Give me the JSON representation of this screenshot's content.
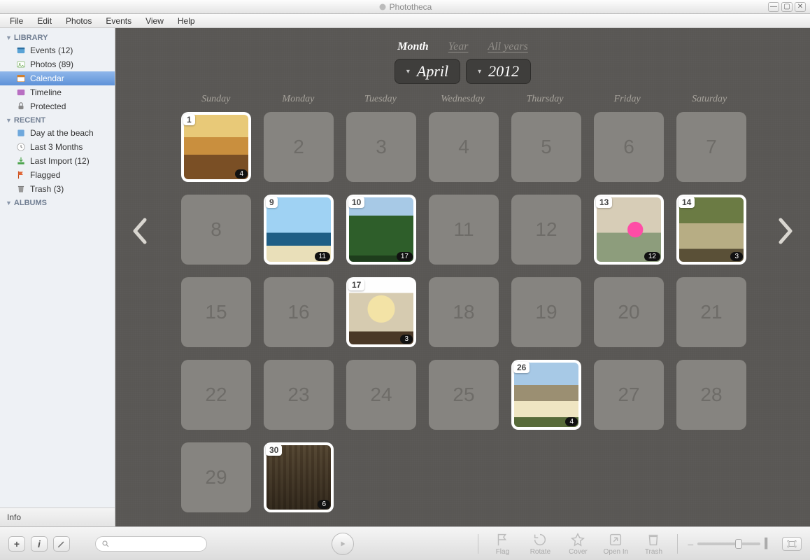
{
  "app": {
    "title": "Phototheca"
  },
  "menu": [
    "File",
    "Edit",
    "Photos",
    "Events",
    "View",
    "Help"
  ],
  "sidebar": {
    "sections": [
      {
        "label": "LIBRARY",
        "items": [
          {
            "icon": "events-icon",
            "label": "Events (12)"
          },
          {
            "icon": "photos-icon",
            "label": "Photos (89)"
          },
          {
            "icon": "calendar-icon",
            "label": "Calendar",
            "selected": true
          },
          {
            "icon": "timeline-icon",
            "label": "Timeline"
          },
          {
            "icon": "protected-icon",
            "label": "Protected"
          }
        ]
      },
      {
        "label": "RECENT",
        "items": [
          {
            "icon": "album-icon",
            "label": "Day at the beach"
          },
          {
            "icon": "clock-icon",
            "label": "Last 3 Months"
          },
          {
            "icon": "import-icon",
            "label": "Last Import (12)"
          },
          {
            "icon": "flag-icon",
            "label": "Flagged"
          },
          {
            "icon": "trash-icon",
            "label": "Trash (3)"
          }
        ]
      },
      {
        "label": "ALBUMS",
        "items": []
      }
    ],
    "info": "Info"
  },
  "view": {
    "tabs": {
      "month": "Month",
      "year": "Year",
      "all": "All years",
      "active": "month"
    },
    "picker": {
      "month": "April",
      "year": "2012"
    },
    "weekdays": [
      "Sunday",
      "Monday",
      "Tuesday",
      "Wednesday",
      "Thursday",
      "Friday",
      "Saturday"
    ]
  },
  "calendar": {
    "cells": [
      {
        "day": 1,
        "photo": true,
        "count": 4,
        "thumb": "t1"
      },
      {
        "day": 2
      },
      {
        "day": 3
      },
      {
        "day": 4
      },
      {
        "day": 5
      },
      {
        "day": 6
      },
      {
        "day": 7
      },
      {
        "day": 8
      },
      {
        "day": 9,
        "photo": true,
        "count": 11,
        "thumb": "t9"
      },
      {
        "day": 10,
        "photo": true,
        "count": 17,
        "thumb": "t10"
      },
      {
        "day": 11
      },
      {
        "day": 12
      },
      {
        "day": 13,
        "photo": true,
        "count": 12,
        "thumb": "t13"
      },
      {
        "day": 14,
        "photo": true,
        "count": 3,
        "thumb": "t14"
      },
      {
        "day": 15
      },
      {
        "day": 16
      },
      {
        "day": 17,
        "photo": true,
        "count": 3,
        "thumb": "t17"
      },
      {
        "day": 18
      },
      {
        "day": 19
      },
      {
        "day": 20
      },
      {
        "day": 21
      },
      {
        "day": 22
      },
      {
        "day": 23
      },
      {
        "day": 24
      },
      {
        "day": 25
      },
      {
        "day": 26,
        "photo": true,
        "count": 4,
        "thumb": "t26"
      },
      {
        "day": 27
      },
      {
        "day": 28
      },
      {
        "day": 29
      },
      {
        "day": 30,
        "photo": true,
        "count": 6,
        "thumb": "t30"
      }
    ]
  },
  "toolbar": {
    "tools": [
      {
        "name": "flag",
        "label": "Flag"
      },
      {
        "name": "rotate",
        "label": "Rotate"
      },
      {
        "name": "cover",
        "label": "Cover"
      },
      {
        "name": "openin",
        "label": "Open In"
      },
      {
        "name": "trash",
        "label": "Trash"
      }
    ]
  }
}
